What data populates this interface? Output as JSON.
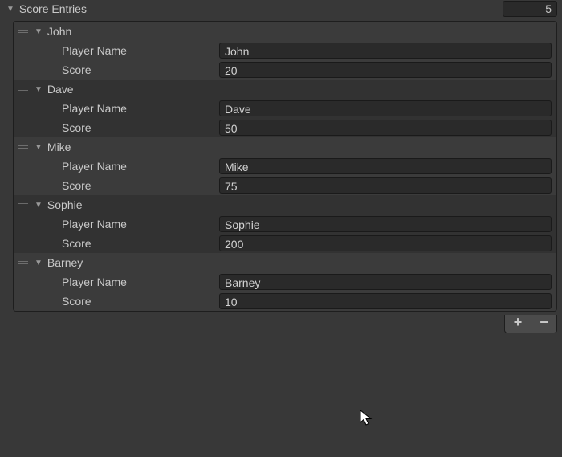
{
  "header": {
    "title": "Score Entries",
    "count": "5"
  },
  "labels": {
    "playerName": "Player Name",
    "score": "Score"
  },
  "buttons": {
    "add": "+",
    "remove": "−"
  },
  "entries": [
    {
      "name": "John",
      "playerName": "John",
      "score": "20"
    },
    {
      "name": "Dave",
      "playerName": "Dave",
      "score": "50"
    },
    {
      "name": "Mike",
      "playerName": "Mike",
      "score": "75"
    },
    {
      "name": "Sophie",
      "playerName": "Sophie",
      "score": "200"
    },
    {
      "name": "Barney",
      "playerName": "Barney",
      "score": "10"
    }
  ]
}
